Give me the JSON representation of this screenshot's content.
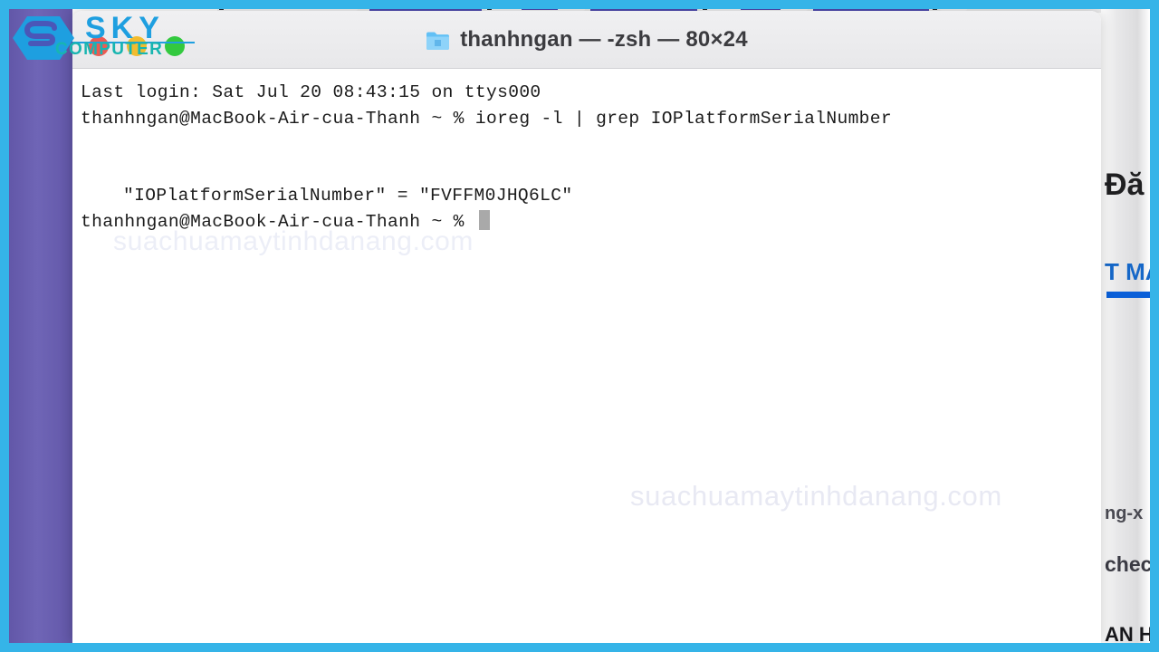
{
  "window": {
    "title": "thanhngan — -zsh — 80×24",
    "folder_icon": "folder-icon",
    "traffic_lights": [
      {
        "name": "close",
        "color": "#ee5a52"
      },
      {
        "name": "minimize",
        "color": "#f2bc2e"
      },
      {
        "name": "zoom",
        "color": "#33c93f"
      }
    ]
  },
  "terminal": {
    "lines": [
      {
        "id": "login",
        "text": "Last login: Sat Jul 20 08:43:15 on ttys000"
      },
      {
        "id": "command",
        "text": "thanhngan@MacBook-Air-cua-Thanh ~ % ioreg -l | grep IOPlatformSerialNumber"
      },
      {
        "id": "blank1",
        "text": ""
      },
      {
        "id": "blank2",
        "text": ""
      },
      {
        "id": "result",
        "text": "\"IOPlatformSerialNumber\" = \"FVFFM0JHQ6LC\""
      },
      {
        "id": "prompt",
        "text": "thanhngan@MacBook-Air-cua-Thanh ~ % "
      }
    ],
    "login_line": "Last login: Sat Jul 20 08:43:15 on ttys000",
    "command_line": "thanhngan@MacBook-Air-cua-Thanh ~ % ioreg -l | grep IOPlatformSerialNumber",
    "result_line": "\"IOPlatformSerialNumber\" = \"FVFFM0JHQ6LC\"",
    "prompt_line": "thanhngan@MacBook-Air-cua-Thanh ~ % ",
    "serial_number": "FVFFM0JHQ6LC",
    "user": "thanhngan",
    "host": "MacBook-Air-cua-Thanh",
    "shell": "-zsh",
    "size": "80×24"
  },
  "watermark": {
    "main": "suachuamaytinhdanang.com",
    "faint": "suachuamaytinhdanang.com"
  },
  "logo": {
    "primary": "SKY",
    "secondary": "COMPUTER"
  },
  "background_page": {
    "heading_fragment": "Đă",
    "blue_fragment": "T MÁ",
    "fragment_1": "ng-x",
    "fragment_2": "checl",
    "fragment_3": "AN H."
  },
  "colors": {
    "frame": "#35b4e8",
    "rail": "#6f65b6",
    "tab_active": "#4f4bb0",
    "accent_blue": "#0a5fd8",
    "cursor": "#a9a9a9"
  }
}
